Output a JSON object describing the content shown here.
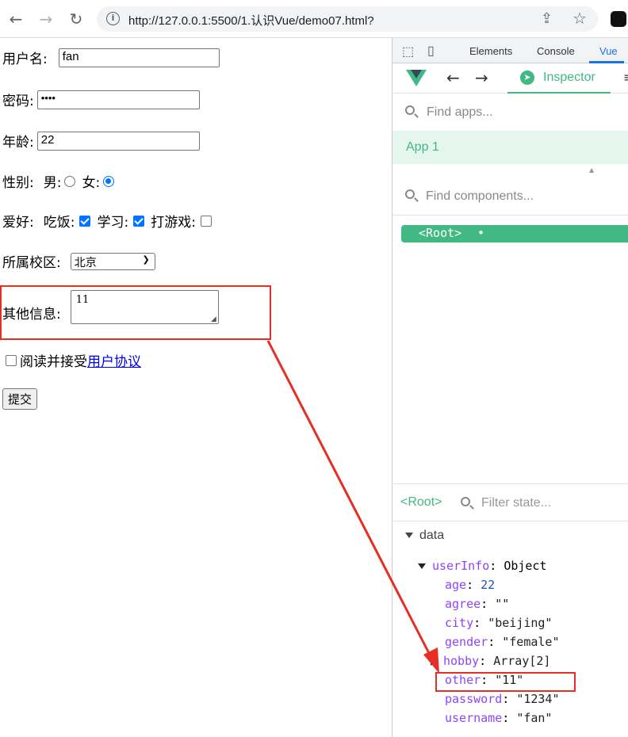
{
  "browser": {
    "url": "http://127.0.0.1:5500/1.认识Vue/demo07.html?"
  },
  "form": {
    "username_label": "用户名:",
    "username_value": "fan",
    "password_label": "密码:",
    "password_value": "••••",
    "age_label": "年龄:",
    "age_value": "22",
    "gender_label": "性别:",
    "gender_male": "男:",
    "gender_female": "女:",
    "hobby_label": "爱好:",
    "hobby_eat": "吃饭:",
    "hobby_study": "学习:",
    "hobby_game": "打游戏:",
    "campus_label": "所属校区:",
    "campus_value": "北京",
    "other_label": "其他信息:",
    "other_value": "11",
    "agree_text": "阅读并接受",
    "agree_link": "用户协议",
    "submit_label": "提交"
  },
  "devtools": {
    "tabs": [
      "Elements",
      "Console",
      "Vue"
    ],
    "inspector_label": "Inspector",
    "find_apps_placeholder": "Find apps...",
    "app_name": "App 1",
    "find_components_placeholder": "Find components...",
    "root_component": "<Root>",
    "state_root_label": "<Root>",
    "filter_state_placeholder": "Filter state...",
    "data_section": "data",
    "userInfo": {
      "key": "userInfo",
      "type": "Object",
      "fields": [
        {
          "key": "age",
          "value": "22",
          "kind": "num"
        },
        {
          "key": "agree",
          "value": "\"\"",
          "kind": "str"
        },
        {
          "key": "city",
          "value": "\"beijing\"",
          "kind": "str"
        },
        {
          "key": "gender",
          "value": "\"female\"",
          "kind": "str"
        },
        {
          "key": "hobby",
          "value": "Array[2]",
          "kind": "str"
        },
        {
          "key": "other",
          "value": "\"11\"",
          "kind": "str"
        },
        {
          "key": "password",
          "value": "\"1234\"",
          "kind": "str"
        },
        {
          "key": "username",
          "value": "\"fan\"",
          "kind": "str"
        }
      ]
    }
  },
  "colors": {
    "vue_green": "#42b883",
    "annotation_red": "#e52e24",
    "checkbox_blue": "#0075ff"
  }
}
